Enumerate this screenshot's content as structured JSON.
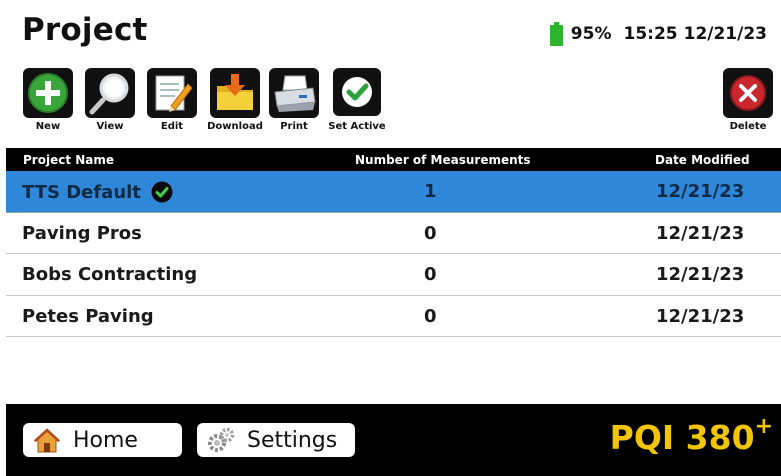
{
  "header": {
    "title": "Project",
    "battery_percent": "95%",
    "battery_level": 0.95,
    "time": "15:25",
    "date": "12/21/23"
  },
  "toolbar": {
    "new_label": "New",
    "view_label": "View",
    "edit_label": "Edit",
    "download_label": "Download",
    "print_label": "Print",
    "set_active_label": "Set Active",
    "delete_label": "Delete"
  },
  "table": {
    "columns": [
      "Project Name",
      "Number of Measurements",
      "Date Modified"
    ],
    "rows": [
      {
        "name": "TTS Default",
        "measurements": "1",
        "date": "12/21/23",
        "active": true,
        "selected": true
      },
      {
        "name": "Paving Pros",
        "measurements": "0",
        "date": "12/21/23",
        "active": false,
        "selected": false
      },
      {
        "name": "Bobs Contracting",
        "measurements": "0",
        "date": "12/21/23",
        "active": false,
        "selected": false
      },
      {
        "name": "Petes Paving",
        "measurements": "0",
        "date": "12/21/23",
        "active": false,
        "selected": false
      }
    ]
  },
  "bottom": {
    "home_label": "Home",
    "settings_label": "Settings",
    "brand": "PQI 380",
    "brand_sup": "+"
  },
  "colors": {
    "selected_row": "#2e87d8",
    "battery": "#2db52d",
    "brand": "#f2c500",
    "toolbar_bg": "#111111"
  },
  "icons": {
    "new": "plus-circle-icon",
    "view": "magnifier-icon",
    "edit": "notepad-pencil-icon",
    "download": "folder-download-icon",
    "print": "printer-icon",
    "set_active": "check-circle-icon",
    "delete": "x-circle-icon",
    "home": "house-icon",
    "settings": "gears-icon"
  }
}
